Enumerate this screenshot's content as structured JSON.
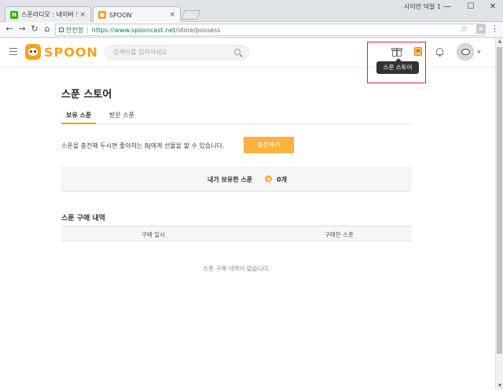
{
  "browser": {
    "tabs": [
      {
        "title": "스푼라디오 : 네이버 통합검색",
        "favicon": "naver-favicon"
      },
      {
        "title": "SPOON",
        "favicon": "spoon-favicon"
      }
    ],
    "user_label": "사이먼 덕일 1",
    "controls": {
      "minimize": "—",
      "maximize": "☐",
      "close": "✕"
    },
    "security_label": "안전함",
    "url_host": "https://www.spooncast.net",
    "url_path": "/store/possess"
  },
  "header": {
    "logo_text": "SPOON",
    "search_placeholder": "검색어를 입력하세요.",
    "tooltip": "스푼 스토어"
  },
  "store": {
    "title": "스푼 스토어",
    "tabs": [
      {
        "label": "보유 스푼",
        "active": true
      },
      {
        "label": "받은 스푼",
        "active": false
      }
    ],
    "description": "스푼을 충전해 두시면 좋아하는 BJ에게 선물을 할 수 있습니다.",
    "charge_button": "충전하기",
    "owned_label": "내가 보유한 스푼",
    "owned_count": "0개",
    "history_title": "스푼 구매 내역",
    "history_columns": [
      "구매 일시",
      "구매한 스푼"
    ],
    "history_empty": "스푼 구매 내역이 없습니다."
  },
  "colors": {
    "brand": "#f7a21c",
    "button": "#f7b33c",
    "highlight": "#e0262c"
  }
}
